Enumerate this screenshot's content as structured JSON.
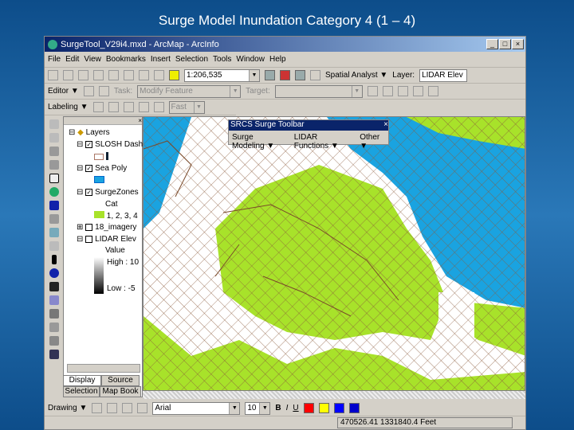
{
  "slide_title": "Surge Model Inundation Category 4 (1 – 4)",
  "window": {
    "title": "SurgeTool_V29i4.mxd - ArcMap - ArcInfo"
  },
  "menu": [
    "File",
    "Edit",
    "View",
    "Bookmarks",
    "Insert",
    "Selection",
    "Tools",
    "Window",
    "Help"
  ],
  "toolbar1": {
    "scale": "1:206,535",
    "spatial_analyst": "Spatial Analyst ▼",
    "layer_label": "Layer:",
    "layer_value": "LIDAR Elev"
  },
  "toolbar2": {
    "editor": "Editor ▼",
    "task_label": "Task:",
    "task_value": "Modify Feature",
    "target_label": "Target:"
  },
  "toolbar3": {
    "labeling": "Labeling ▼",
    "font_value": "Fast"
  },
  "toc": {
    "root": "Layers",
    "layers": [
      {
        "name": "SLOSH Dash",
        "checked": true
      },
      {
        "name": "Sea Poly",
        "checked": true
      },
      {
        "name": "SurgeZones",
        "checked": true,
        "field": "Cat",
        "class": "1, 2, 3, 4"
      },
      {
        "name": "18_imagery",
        "checked": false
      },
      {
        "name": "LIDAR Elev",
        "checked": false,
        "field": "Value",
        "high": "High : 10",
        "low": "Low : -5"
      }
    ],
    "tabs": [
      "Display",
      "Source",
      "Selection",
      "Map Book"
    ]
  },
  "float_toolbar": {
    "title": "SRCS Surge Toolbar",
    "menus": [
      "Surge Modeling ▼",
      "LIDAR Functions ▼",
      "Other ▼"
    ]
  },
  "drawing": {
    "label": "Drawing ▼",
    "font": "Arial",
    "size": "10",
    "bold": "B",
    "italic": "I",
    "underline": "U"
  },
  "status": {
    "coords": "470526.41  1331840.4 Feet"
  },
  "colors": {
    "water": "#1aa3e0",
    "land": "#a8e22a",
    "grid": "#8a5a3a"
  }
}
